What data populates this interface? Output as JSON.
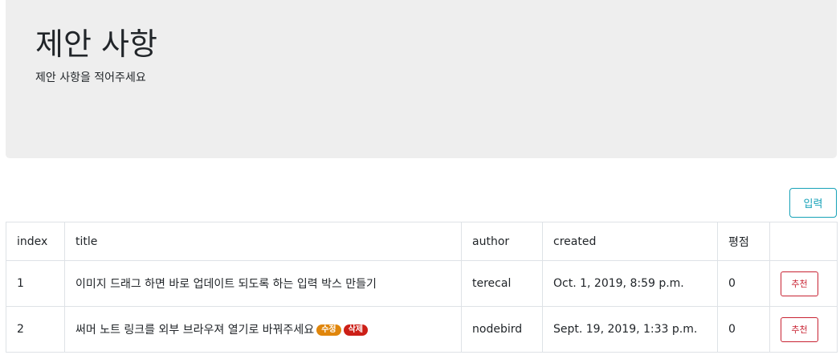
{
  "header": {
    "title": "제안 사항",
    "subtitle": "제안 사항을 적어주세요"
  },
  "toolbar": {
    "input_label": "입력"
  },
  "table": {
    "columns": [
      "index",
      "title",
      "author",
      "created",
      "평점",
      ""
    ],
    "rows": [
      {
        "index": "1",
        "title": "이미지 드래그 하면 바로 업데이트 되도록 하는 입력 박스 만들기",
        "author": "terecal",
        "created": "Oct. 1, 2019, 8:59 p.m.",
        "rating": "0",
        "recommend_label": "추천"
      },
      {
        "index": "2",
        "title": "써머 노트 링크를 외부 브라우져 열기로 바꿔주세요",
        "badge_edit": "수정",
        "badge_delete": "삭제",
        "author": "nodebird",
        "created": "Sept. 19, 2019, 1:33 p.m.",
        "rating": "0",
        "recommend_label": "추천"
      }
    ]
  },
  "colors": {
    "jumbotron_bg": "#eeeeee",
    "info": "#17a2b8",
    "danger": "#c82333",
    "badge_edit": "#e0860b",
    "badge_delete": "#cc1f17"
  }
}
